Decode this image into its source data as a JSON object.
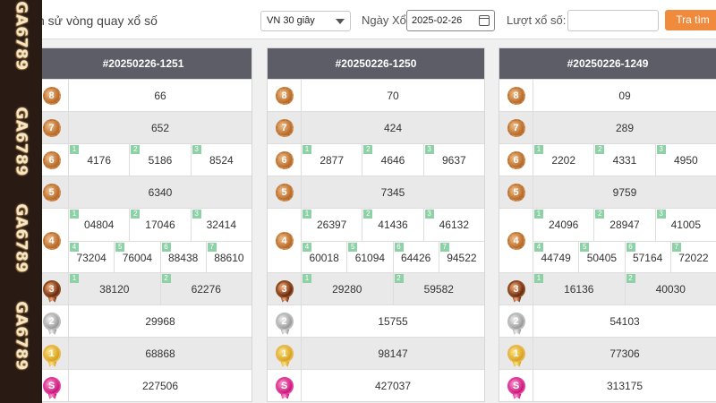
{
  "brand": {
    "word": "GA6789"
  },
  "filters": {
    "title": "ch sử vòng quay xổ số",
    "game_select": "VN 30 giây",
    "date_label": "Ngày Xổ:",
    "date_value": "2025-02-26",
    "round_label": "Lượt xổ số:",
    "round_value": "",
    "search_button": "Tra tìm"
  },
  "cards": [
    {
      "header": "#20250226-1251",
      "rows": [
        {
          "prize": "8",
          "values": [
            "66"
          ]
        },
        {
          "prize": "7",
          "values": [
            "652"
          ]
        },
        {
          "prize": "6",
          "values": [
            "4176",
            "5186",
            "8524"
          ]
        },
        {
          "prize": "5",
          "values": [
            "6340"
          ]
        },
        {
          "prize": "4",
          "values": [
            "04804",
            "17046",
            "32414",
            "73204",
            "76004",
            "88438",
            "88610"
          ]
        },
        {
          "prize": "3",
          "values": [
            "38120",
            "62276"
          ]
        },
        {
          "prize": "2",
          "values": [
            "29968"
          ]
        },
        {
          "prize": "1",
          "values": [
            "68868"
          ]
        },
        {
          "prize": "S",
          "values": [
            "227506"
          ]
        }
      ]
    },
    {
      "header": "#20250226-1250",
      "rows": [
        {
          "prize": "8",
          "values": [
            "70"
          ]
        },
        {
          "prize": "7",
          "values": [
            "424"
          ]
        },
        {
          "prize": "6",
          "values": [
            "2877",
            "4646",
            "9637"
          ]
        },
        {
          "prize": "5",
          "values": [
            "7345"
          ]
        },
        {
          "prize": "4",
          "values": [
            "26397",
            "41436",
            "46132",
            "60018",
            "61094",
            "64426",
            "94522"
          ]
        },
        {
          "prize": "3",
          "values": [
            "29280",
            "59582"
          ]
        },
        {
          "prize": "2",
          "values": [
            "15755"
          ]
        },
        {
          "prize": "1",
          "values": [
            "98147"
          ]
        },
        {
          "prize": "S",
          "values": [
            "427037"
          ]
        }
      ]
    },
    {
      "header": "#20250226-1249",
      "rows": [
        {
          "prize": "8",
          "values": [
            "09"
          ]
        },
        {
          "prize": "7",
          "values": [
            "289"
          ]
        },
        {
          "prize": "6",
          "values": [
            "2202",
            "4331",
            "4950"
          ]
        },
        {
          "prize": "5",
          "values": [
            "9759"
          ]
        },
        {
          "prize": "4",
          "values": [
            "24096",
            "28947",
            "41005",
            "44749",
            "50405",
            "57164",
            "72022"
          ]
        },
        {
          "prize": "3",
          "values": [
            "16136",
            "40030"
          ]
        },
        {
          "prize": "2",
          "values": [
            "54103"
          ]
        },
        {
          "prize": "1",
          "values": [
            "77306"
          ]
        },
        {
          "prize": "S",
          "values": [
            "313175"
          ]
        }
      ]
    }
  ]
}
